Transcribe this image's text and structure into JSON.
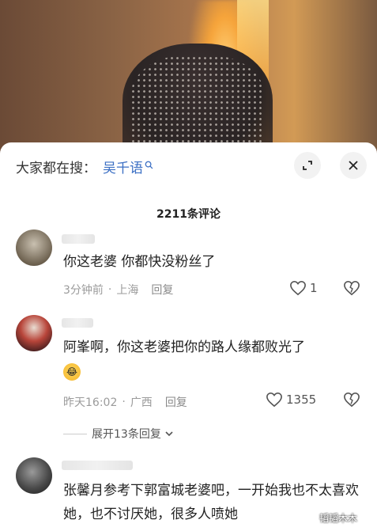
{
  "search": {
    "prefix": "大家都在搜：",
    "term": "吴千语"
  },
  "header": {
    "comment_count": "2211条评论"
  },
  "comments": [
    {
      "text": "你这老婆 你都快没粉丝了",
      "time": "3分钟前",
      "location": "上海",
      "reply_label": "回复",
      "likes": "1"
    },
    {
      "text": "阿峯啊，你这老婆把你的路人缘都败光了",
      "time": "昨天16:02",
      "location": "广西",
      "reply_label": "回复",
      "likes": "1355",
      "emoji": "😂"
    },
    {
      "text": "张馨月参考下郭富城老婆吧，一开始我也不太喜欢她，也不讨厌她，很多人喷她"
    }
  ],
  "expand_replies": "展开13条回复",
  "watermark": "韬韬木木",
  "colors": {
    "link_blue": "#3b6fc4",
    "meta_gray": "#9b9b9b"
  }
}
